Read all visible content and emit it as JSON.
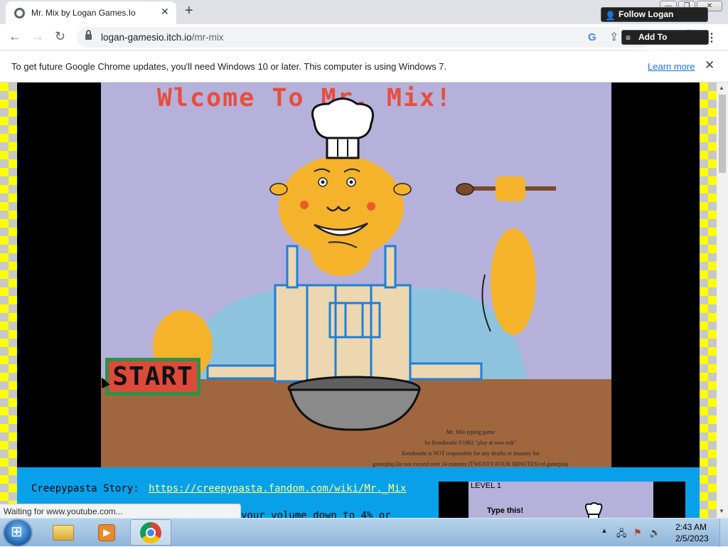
{
  "browser": {
    "tab_title": "Mr. Mix by Logan Games.Io",
    "url_host": "logan-gamesio.itch.io",
    "url_path": "/mr-mix",
    "new_tab_symbol": "+",
    "close_symbol": "✕"
  },
  "infobar": {
    "message": "To get future Google Chrome updates, you'll need Windows 10 or later. This computer is using Windows 7.",
    "link": "Learn more"
  },
  "game": {
    "title": "Wlcome To Mr. Mix!",
    "start_label": "START",
    "credits_line1": "Mr. Mix typing game",
    "credits_line2": "by Kendooshi ©1982 \"play at own risk\"",
    "credits_line3": "Kendooshi is NOT responsible for any deaths or insanity for",
    "credits_line4": "gameplay.Do not exceed over 24 minutes (TWENTY-FOUR MINUTES) of gameplay"
  },
  "itch": {
    "follow_label": "Follow Logan Games.Io",
    "collection_label": "Add To Collection"
  },
  "description": {
    "story_label": "Creepypasta Story:",
    "story_link": "https://creepypasta.fandom.com/wiki/Mr._Mix",
    "volume_text": "your volume down to 4% or",
    "preview_level": "LEVEL 1",
    "preview_prompt": "Type this!"
  },
  "status": {
    "loading_text": "Waiting for www.youtube.com..."
  },
  "taskbar": {
    "time": "2:43 AM",
    "date": "2/5/2023"
  },
  "colors": {
    "game_background": "#b5b1db",
    "title_red": "#e94d3c",
    "start_green": "#2e9149",
    "start_red": "#de4a3a",
    "page_yellow": "#ffff00",
    "panel_blue": "#09a0ea"
  },
  "icons": {
    "back": "arrow-left-icon",
    "forward": "arrow-right-icon",
    "reload": "reload-icon",
    "lock": "lock-icon",
    "google": "google-lens-icon",
    "share": "share-icon",
    "bookmark": "star-icon"
  }
}
